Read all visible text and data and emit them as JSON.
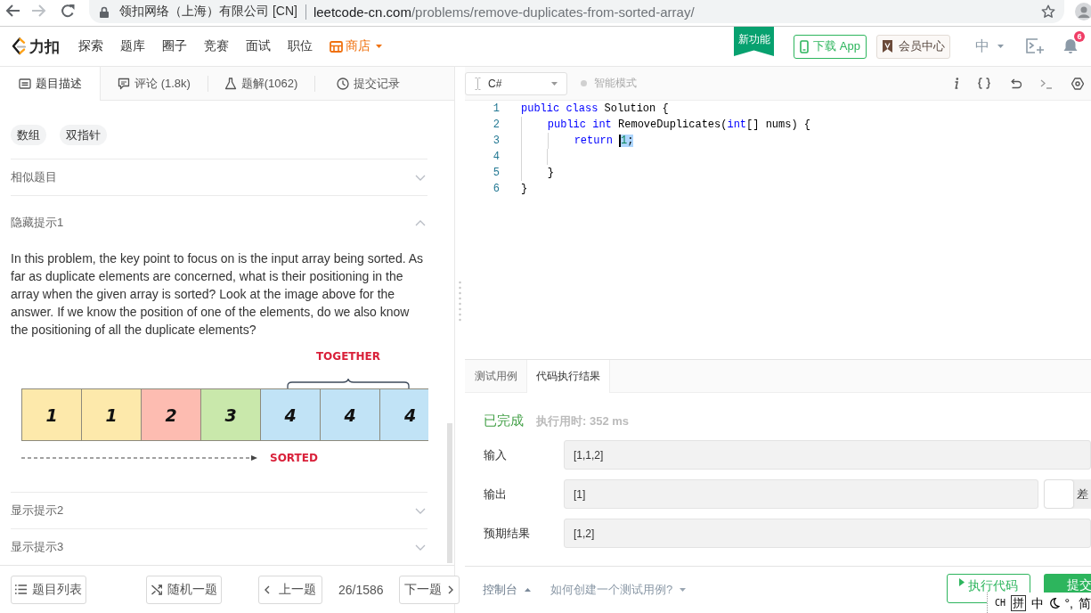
{
  "browser": {
    "site_info": "领扣网络（上海）有限公司 [CN]",
    "url_host": "leetcode-cn.com",
    "url_path": "/problems/remove-duplicates-from-sorted-array/"
  },
  "site_nav": {
    "logo": "力扣",
    "items": [
      {
        "label": "探索",
        "kind": "link"
      },
      {
        "label": "题库",
        "kind": "link"
      },
      {
        "label": "圈子",
        "kind": "link"
      },
      {
        "label": "竞赛",
        "kind": "link"
      },
      {
        "label": "面试",
        "kind": "link"
      },
      {
        "label": "职位",
        "kind": "link"
      },
      {
        "label": "商店",
        "kind": "store"
      }
    ],
    "ribbon": "新功能",
    "download_button": "下载 App",
    "member_button": "会员中心",
    "language_menu": "中",
    "notification_badge": "6"
  },
  "problem_tabs": [
    {
      "label": "题目描述",
      "selected": true
    },
    {
      "label": "评论 (1.8k)",
      "selected": false
    },
    {
      "label": "题解(1062)",
      "selected": false
    },
    {
      "label": "提交记录",
      "selected": false
    }
  ],
  "description": {
    "tags": [
      "数组",
      "双指针"
    ],
    "sections": [
      {
        "title": "相似题目",
        "expanded": false
      },
      {
        "title": "隐藏提示1",
        "expanded": true,
        "text": "In this problem, the key point to focus on is the input array being sorted. As far as duplicate elements are concerned, what is their positioning in the array when the given array is sorted? Look at the image above for the answer. If we know the position of one of the elements, do we also know the positioning of all the duplicate elements?",
        "figure": {
          "brace_label": "TOGETHER",
          "arrow_label": "SORTED",
          "cells": [
            {
              "value": "1",
              "color": "#fde9ab"
            },
            {
              "value": "1",
              "color": "#fde9ab"
            },
            {
              "value": "2",
              "color": "#fdbcb1"
            },
            {
              "value": "3",
              "color": "#c9e8ab"
            },
            {
              "value": "4",
              "color": "#c1e3f6"
            },
            {
              "value": "4",
              "color": "#c1e3f6"
            },
            {
              "value": "4",
              "color": "#c1e3f6"
            }
          ]
        }
      },
      {
        "title": "显示提示2",
        "expanded": false
      },
      {
        "title": "显示提示3",
        "expanded": false
      }
    ]
  },
  "pager": {
    "list_button": "题目列表",
    "random_button": "随机一题",
    "prev_button": "上一题",
    "counter": "26/1586",
    "next_button": "下一题"
  },
  "editor_toolbar": {
    "language": "C#",
    "smart_mode": {
      "label": "智能模式",
      "on": false
    }
  },
  "editor": {
    "lines": [
      {
        "number": "1",
        "tokens": [
          {
            "kind": "keyword",
            "text": "public class",
            "selected": false,
            "cursor": false
          },
          {
            "kind": "plain",
            "text": " Solution {",
            "selected": false,
            "cursor": false
          }
        ]
      },
      {
        "number": "2",
        "tokens": [
          {
            "kind": "keyword",
            "text": "    public int",
            "selected": false,
            "cursor": false
          },
          {
            "kind": "plain",
            "text": " RemoveDuplicates(",
            "selected": false,
            "cursor": false
          },
          {
            "kind": "keyword",
            "text": "int",
            "selected": false,
            "cursor": false
          },
          {
            "kind": "plain",
            "text": "[] nums) {",
            "selected": false,
            "cursor": false
          }
        ]
      },
      {
        "number": "3",
        "tokens": [
          {
            "kind": "keyword",
            "text": "        return ",
            "selected": false,
            "cursor": false
          },
          {
            "kind": "number",
            "text": "1",
            "selected": true,
            "cursor": true
          },
          {
            "kind": "plain",
            "text": ";",
            "selected": true,
            "cursor": false
          }
        ]
      },
      {
        "number": "4"
      },
      {
        "number": "5",
        "tokens": [
          {
            "kind": "plain",
            "text": "    }",
            "selected": false,
            "cursor": false
          }
        ]
      },
      {
        "number": "6",
        "tokens": [
          {
            "kind": "plain",
            "text": "}",
            "selected": false,
            "cursor": false
          }
        ]
      }
    ]
  },
  "result": {
    "tabs": [
      {
        "label": "测试用例",
        "selected": false
      },
      {
        "label": "代码执行结果",
        "selected": true
      }
    ],
    "status": "已完成",
    "runtime": "执行用时: 352 ms",
    "rows": [
      {
        "label": "输入",
        "value": "[1,1,2]"
      },
      {
        "label": "输出",
        "value": "[1]",
        "toggle": {
          "label": "差",
          "on": false
        }
      },
      {
        "label": "预期结果",
        "value": "[1,2]"
      }
    ]
  },
  "footer": {
    "console": "控制台",
    "help": "如何创建一个测试用例?",
    "run_button": "执行代码",
    "submit_button": "提交"
  },
  "ime_toolbar": {
    "items": [
      {
        "kind": "text",
        "text": "CH"
      },
      {
        "kind": "boxed",
        "text": "拼"
      },
      {
        "kind": "text",
        "text": "中"
      },
      {
        "kind": "moon"
      },
      {
        "kind": "text",
        "text": "°,"
      },
      {
        "kind": "text",
        "text": "简"
      }
    ]
  }
}
